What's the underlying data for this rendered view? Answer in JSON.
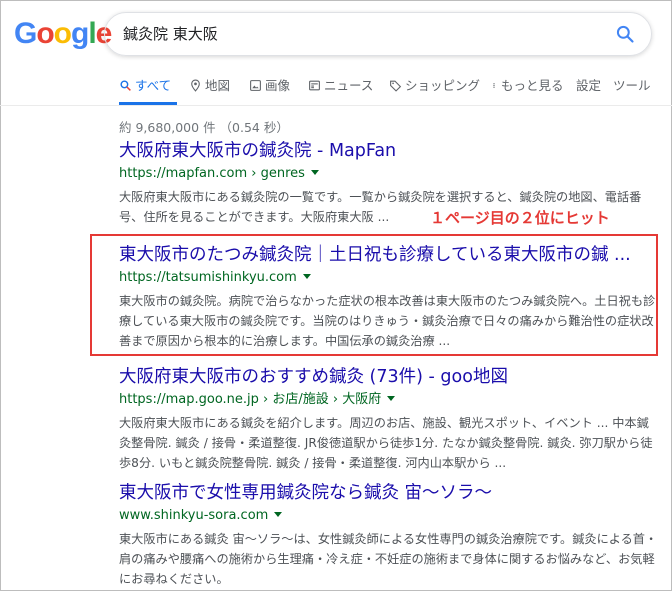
{
  "search": {
    "query": "鍼灸院 東大阪"
  },
  "logo": {
    "letters": [
      "G",
      "o",
      "o",
      "g",
      "l",
      "e"
    ],
    "colors": [
      "#4285f4",
      "#ea4335",
      "#fbbc05",
      "#4285f4",
      "#34a853",
      "#ea4335"
    ]
  },
  "tabs": {
    "all": "すべて",
    "maps": "地図",
    "images": "画像",
    "news": "ニュース",
    "shopping": "ショッピング",
    "more": "もっと見る",
    "settings": "設定",
    "tools": "ツール"
  },
  "stats": "約 9,680,000 件 （0.54 秒）",
  "annotation": "１ページ目の２位にヒット",
  "results": [
    {
      "title": "大阪府東大阪市の鍼灸院 - MapFan",
      "url": "https://mapfan.com › genres",
      "snippet": "大阪府東大阪市にある鍼灸院の一覧です。一覧から鍼灸院を選択すると、鍼灸院の地図、電話番号、住所を見ることができます。大阪府東大阪 ..."
    },
    {
      "title": "東大阪市のたつみ鍼灸院｜土日祝も診療している東大阪市の鍼 ...",
      "url": "https://tatsumishinkyu.com",
      "snippet": "東大阪市の鍼灸院。病院で治らなかった症状の根本改善は東大阪市のたつみ鍼灸院へ。土日祝も診療している東大阪市の鍼灸院です。当院のはりきゅう・鍼灸治療で日々の痛みから難治性の症状改善まで原因から根本的に治療します。中国伝承の鍼灸治療 ..."
    },
    {
      "title": "大阪府東大阪市のおすすめ鍼灸 (73件) - goo地図",
      "url": "https://map.goo.ne.jp › お店/施設 › 大阪府",
      "snippet": "大阪府東大阪市にある鍼灸を紹介します。周辺のお店、施設、観光スポット、イベント ... 中本鍼灸整骨院. 鍼灸 / 接骨・柔道整復. JR俊徳道駅から徒歩1分. たなか鍼灸整骨院. 鍼灸. 弥刀駅から徒歩8分. いもと鍼灸院整骨院. 鍼灸 / 接骨・柔道整復. 河内山本駅から ..."
    },
    {
      "title": "東大阪市で女性専用鍼灸院なら鍼灸 宙〜ソラ〜",
      "url": "www.shinkyu-sora.com",
      "snippet": "東大阪市にある鍼灸 宙〜ソラ〜は、女性鍼灸師による女性専門の鍼灸治療院です。鍼灸による首・肩の痛みや腰痛への施術から生理痛・冷え症・不妊症の施術まで身体に関するお悩みなど、お気軽にお尋ねください。"
    }
  ],
  "colors": {
    "link": "#1a0dab",
    "url": "#006621",
    "accent": "#1a73e8",
    "annotation": "#e53935"
  }
}
